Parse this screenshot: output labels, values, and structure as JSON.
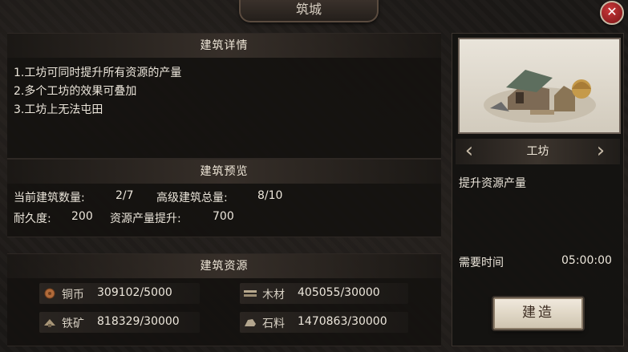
{
  "window": {
    "title": "筑城",
    "close_label": "✕"
  },
  "details": {
    "header": "建筑详情",
    "lines": [
      "1.工坊可同时提升所有资源的产量",
      "2.多个工坊的效果可叠加",
      "3.工坊上无法屯田"
    ]
  },
  "preview": {
    "header": "建筑预览",
    "current_count_label": "当前建筑数量:",
    "current_count_value": "2/7",
    "advanced_total_label": "高级建筑总量:",
    "advanced_total_value": "8/10",
    "durability_label": "耐久度:",
    "durability_value": "200",
    "boost_label": "资源产量提升:",
    "boost_value": "700"
  },
  "resources": {
    "header": "建筑资源",
    "items": [
      {
        "name": "铜币",
        "value": "309102/5000",
        "icon": "copper-coin-icon",
        "color": "#b06a3a"
      },
      {
        "name": "木材",
        "value": "405055/30000",
        "icon": "wood-icon",
        "color": "#b8a98e"
      },
      {
        "name": "铁矿",
        "value": "818329/30000",
        "icon": "iron-ore-icon",
        "color": "#a89678"
      },
      {
        "name": "石料",
        "value": "1470863/30000",
        "icon": "stone-icon",
        "color": "#b3a68e"
      }
    ]
  },
  "building": {
    "name": "工坊",
    "description": "提升资源产量",
    "time_label": "需要时间",
    "time_value": "05:00:00",
    "build_label": "建造",
    "prev_arrow": "‹",
    "next_arrow": "›"
  }
}
